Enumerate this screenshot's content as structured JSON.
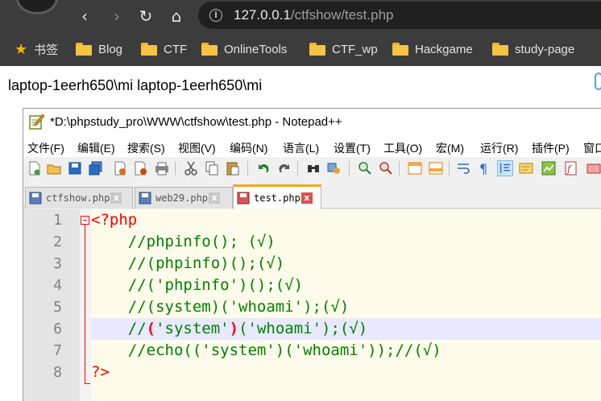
{
  "browser": {
    "back_icon": "‹",
    "forward_icon": "›",
    "reload_icon": "↻",
    "home_icon": "⌂",
    "info_icon": "i",
    "url_host": "127.0.0.1",
    "url_path": "/ctfshow/test.php"
  },
  "bookmarks": {
    "bookmarks_label": "书签",
    "items": [
      "Blog",
      "CTF",
      "OnlineTools",
      "CTF_wp",
      "Hackgame",
      "study-page"
    ]
  },
  "page": {
    "output": "laptop-1eerh650\\mi laptop-1eerh650\\mi"
  },
  "notepad": {
    "title": "*D:\\phpstudy_pro\\WWW\\ctfshow\\test.php - Notepad++",
    "menu": [
      "文件(F)",
      "编辑(E)",
      "搜索(S)",
      "视图(V)",
      "编码(N)",
      "语言(L)",
      "设置(T)",
      "工具(O)",
      "宏(M)",
      "运行(R)",
      "插件(P)",
      "窗口"
    ],
    "tabs": [
      {
        "label": "ctfshow.php",
        "close": "x"
      },
      {
        "label": "web29.php",
        "close": "x"
      },
      {
        "label": "test.php",
        "close": "x"
      }
    ],
    "lines": [
      {
        "num": "1",
        "tag": "<?php"
      },
      {
        "num": "2",
        "text": "    //phpinfo(); (√)"
      },
      {
        "num": "3",
        "text": "    //(phpinfo)();(√)"
      },
      {
        "num": "4",
        "text": "    //('phpinfo')();(√)"
      },
      {
        "num": "5",
        "text": "    //(system)('whoami');(√)"
      },
      {
        "num": "6",
        "pre": "    //",
        "open": "(",
        "mid": "'system'",
        "close": ")",
        "post": "('whoami');(√)"
      },
      {
        "num": "7",
        "text": "    //echo(('system')('whoami'));//(√)"
      },
      {
        "num": "8",
        "tag": "?>"
      }
    ]
  },
  "colors": {
    "comment": "#008000",
    "php_tag": "#ff0000",
    "current_line": "#e8e8ff",
    "active_tab_accent": "#f5a623"
  }
}
